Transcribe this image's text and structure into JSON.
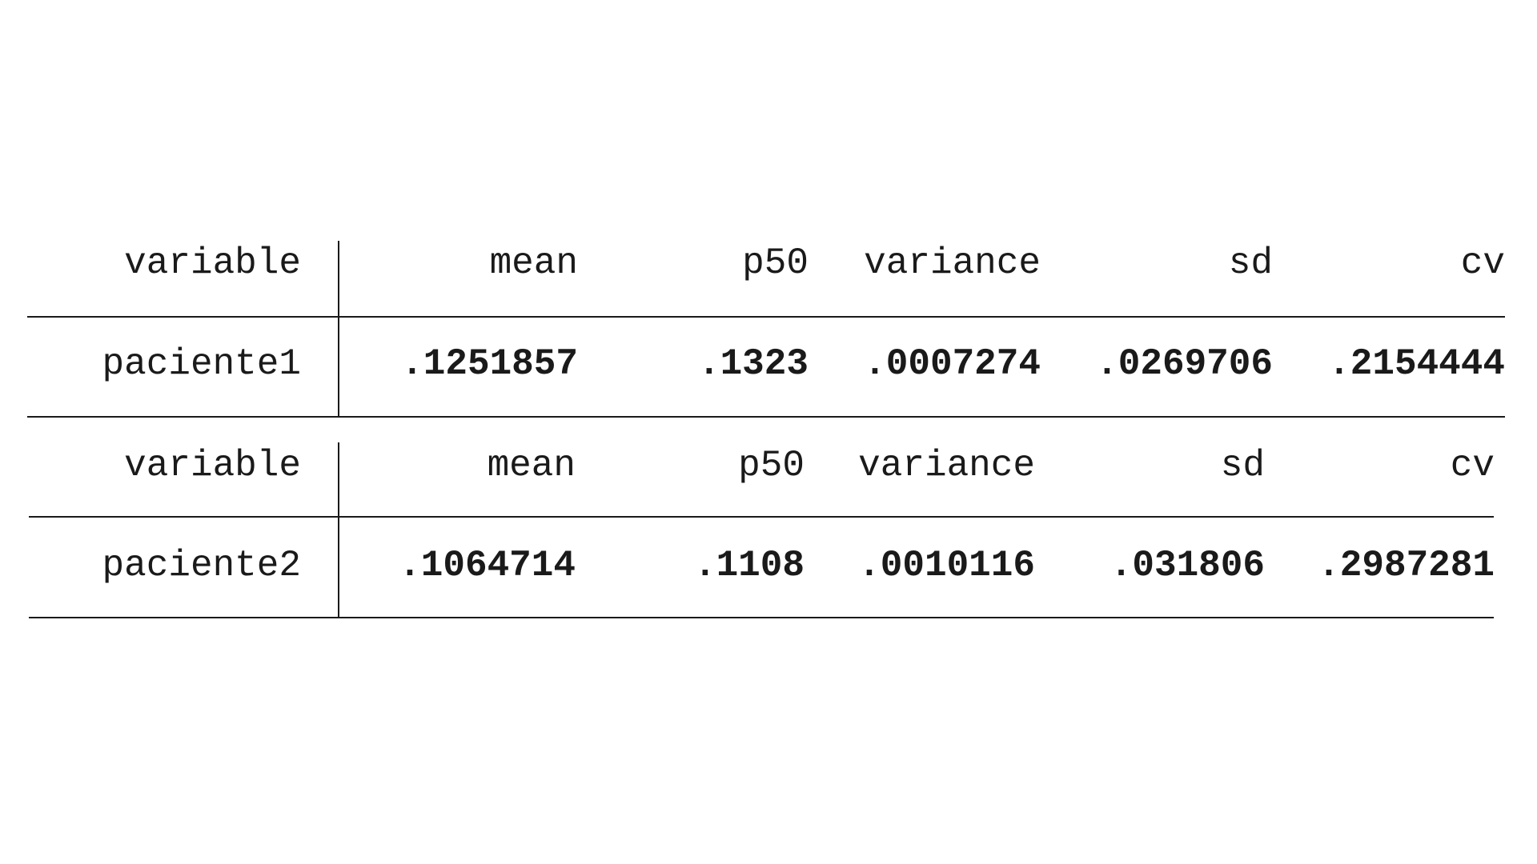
{
  "tables": [
    {
      "headers": [
        "variable",
        "mean",
        "p50",
        "variance",
        "sd",
        "cv"
      ],
      "row": [
        "paciente1",
        ".1251857",
        ".1323",
        ".0007274",
        ".0269706",
        ".2154444"
      ]
    },
    {
      "headers": [
        "variable",
        "mean",
        "p50",
        "variance",
        "sd",
        "cv"
      ],
      "row": [
        "paciente2",
        ".1064714",
        ".1108",
        ".0010116",
        ".031806",
        ".2987281"
      ]
    }
  ]
}
